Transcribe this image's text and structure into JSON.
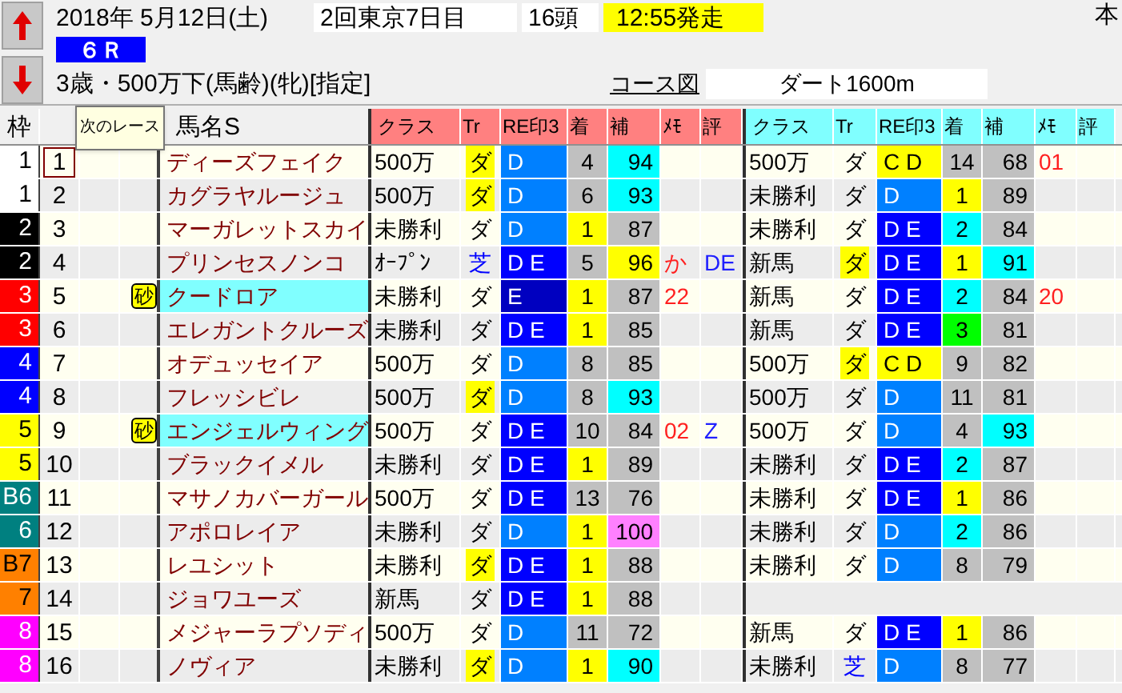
{
  "header": {
    "date": "2018年 5月12日(土)",
    "meeting": "2回東京7日目",
    "runners": "16頭",
    "start_time": "12:55発走",
    "edge_text": "本",
    "race_no": "６Ｒ",
    "conditions": "3歳・500万下(馬齢)(牝)[指定]",
    "course_link": "コース図",
    "course": "ダート1600m"
  },
  "tooltip": "次のレース",
  "columns": {
    "waku": "枠",
    "name": "馬名S",
    "cur_group": [
      "クラス",
      "Tr",
      "RE印3",
      "着",
      "補",
      "ﾒﾓ",
      "評"
    ],
    "prev_group": [
      "クラス",
      "Tr",
      "RE印3",
      "着",
      "補",
      "ﾒﾓ",
      "評"
    ]
  },
  "rows": [
    {
      "waku": "1",
      "color": "#ffffff",
      "num": "1",
      "selected": true,
      "sand": false,
      "name": "ディーズフェイク",
      "name_hl": false,
      "cur": {
        "cls": "500万",
        "tr": {
          "text": "ダ",
          "hl": true
        },
        "re": {
          "text": "D",
          "color": "#0080ff"
        },
        "chaku": {
          "text": "4",
          "color": "#c0c0c0"
        },
        "ho": {
          "text": "94",
          "color": "#00ffff"
        }
      },
      "prev": {
        "cls": "500万",
        "tr": {
          "text": "ダ",
          "hl": false
        },
        "re": {
          "text": "C D",
          "color": "#ffff00"
        },
        "chaku": {
          "text": "14",
          "color": "#c0c0c0"
        },
        "ho": {
          "text": "68",
          "color": "#c0c0c0"
        },
        "memo": "01"
      }
    },
    {
      "waku": "1",
      "color": "#ffffff",
      "num": "2",
      "selected": false,
      "sand": false,
      "name": "カグラヤルージュ",
      "name_hl": false,
      "cur": {
        "cls": "500万",
        "tr": {
          "text": "ダ",
          "hl": true
        },
        "re": {
          "text": "D",
          "color": "#0080ff"
        },
        "chaku": {
          "text": "6",
          "color": "#c0c0c0"
        },
        "ho": {
          "text": "93",
          "color": "#00ffff"
        }
      },
      "prev": {
        "cls": "未勝利",
        "tr": {
          "text": "ダ",
          "hl": false
        },
        "re": {
          "text": "D",
          "color": "#0080ff"
        },
        "chaku": {
          "text": "1",
          "color": "#ffff00"
        },
        "ho": {
          "text": "89",
          "color": "#c0c0c0"
        }
      }
    },
    {
      "waku": "2",
      "color": "#000000",
      "num": "3",
      "selected": false,
      "sand": false,
      "name": "マーガレットスカイ",
      "name_hl": false,
      "cur": {
        "cls": "未勝利",
        "tr": {
          "text": "ダ",
          "hl": false
        },
        "re": {
          "text": "D",
          "color": "#0080ff"
        },
        "chaku": {
          "text": "1",
          "color": "#ffff00"
        },
        "ho": {
          "text": "87",
          "color": "#c0c0c0"
        }
      },
      "prev": {
        "cls": "未勝利",
        "tr": {
          "text": "ダ",
          "hl": false
        },
        "re": {
          "text": "D E",
          "color": "#0000ff"
        },
        "chaku": {
          "text": "2",
          "color": "#00ffff"
        },
        "ho": {
          "text": "84",
          "color": "#c0c0c0"
        }
      }
    },
    {
      "waku": "2",
      "color": "#000000",
      "num": "4",
      "selected": false,
      "sand": false,
      "name": "プリンセスノンコ",
      "name_hl": false,
      "cur": {
        "cls": "ｵｰﾌﾟﾝ",
        "tr": {
          "text": "芝",
          "hl": false,
          "color": "#0000ff"
        },
        "re": {
          "text": "D E",
          "color": "#0000ff"
        },
        "chaku": {
          "text": "5",
          "color": "#c0c0c0"
        },
        "ho": {
          "text": "96",
          "color": "#ffff00"
        },
        "memo": "か",
        "hyo": "DE"
      },
      "prev": {
        "cls": "新馬",
        "tr": {
          "text": "ダ",
          "hl": true
        },
        "re": {
          "text": "D E",
          "color": "#0000ff"
        },
        "chaku": {
          "text": "1",
          "color": "#ffff00"
        },
        "ho": {
          "text": "91",
          "color": "#00ffff"
        }
      }
    },
    {
      "waku": "3",
      "color": "#ff0000",
      "num": "5",
      "selected": false,
      "sand": true,
      "sand_label": "砂",
      "name": "クードロア",
      "name_hl": true,
      "cur": {
        "cls": "未勝利",
        "tr": {
          "text": "ダ",
          "hl": false
        },
        "re": {
          "text": "E",
          "color": "#0000c0"
        },
        "chaku": {
          "text": "1",
          "color": "#ffff00"
        },
        "ho": {
          "text": "87",
          "color": "#c0c0c0"
        },
        "memo": "22"
      },
      "prev": {
        "cls": "新馬",
        "tr": {
          "text": "ダ",
          "hl": false
        },
        "re": {
          "text": "D E",
          "color": "#0000ff"
        },
        "chaku": {
          "text": "2",
          "color": "#00ffff"
        },
        "ho": {
          "text": "84",
          "color": "#c0c0c0"
        },
        "memo": "20"
      }
    },
    {
      "waku": "3",
      "color": "#ff0000",
      "num": "6",
      "selected": false,
      "sand": false,
      "name": "エレガントクルーズ",
      "name_hl": false,
      "cur": {
        "cls": "未勝利",
        "tr": {
          "text": "ダ",
          "hl": false
        },
        "re": {
          "text": "D E",
          "color": "#0000ff"
        },
        "chaku": {
          "text": "1",
          "color": "#ffff00"
        },
        "ho": {
          "text": "85",
          "color": "#c0c0c0"
        }
      },
      "prev": {
        "cls": "新馬",
        "tr": {
          "text": "ダ",
          "hl": false
        },
        "re": {
          "text": "D E",
          "color": "#0000ff"
        },
        "chaku": {
          "text": "3",
          "color": "#00ff00"
        },
        "ho": {
          "text": "81",
          "color": "#c0c0c0"
        }
      }
    },
    {
      "waku": "4",
      "color": "#0000ff",
      "num": "7",
      "selected": false,
      "sand": false,
      "name": "オデュッセイア",
      "name_hl": false,
      "cur": {
        "cls": "500万",
        "tr": {
          "text": "ダ",
          "hl": false
        },
        "re": {
          "text": "D",
          "color": "#0080ff"
        },
        "chaku": {
          "text": "8",
          "color": "#c0c0c0"
        },
        "ho": {
          "text": "85",
          "color": "#c0c0c0"
        }
      },
      "prev": {
        "cls": "500万",
        "tr": {
          "text": "ダ",
          "hl": true
        },
        "re": {
          "text": "C D",
          "color": "#ffff00"
        },
        "chaku": {
          "text": "9",
          "color": "#c0c0c0"
        },
        "ho": {
          "text": "82",
          "color": "#c0c0c0"
        }
      }
    },
    {
      "waku": "4",
      "color": "#0000ff",
      "num": "8",
      "selected": false,
      "sand": false,
      "name": "フレッシビレ",
      "name_hl": false,
      "cur": {
        "cls": "500万",
        "tr": {
          "text": "ダ",
          "hl": true
        },
        "re": {
          "text": "D",
          "color": "#0080ff"
        },
        "chaku": {
          "text": "8",
          "color": "#c0c0c0"
        },
        "ho": {
          "text": "93",
          "color": "#00ffff"
        }
      },
      "prev": {
        "cls": "500万",
        "tr": {
          "text": "ダ",
          "hl": false
        },
        "re": {
          "text": "D",
          "color": "#0080ff"
        },
        "chaku": {
          "text": "11",
          "color": "#c0c0c0"
        },
        "ho": {
          "text": "81",
          "color": "#c0c0c0"
        }
      }
    },
    {
      "waku": "5",
      "color": "#ffff00",
      "num": "9",
      "selected": false,
      "sand": true,
      "sand_label": "砂",
      "name": "エンジェルウィング",
      "name_hl": true,
      "cur": {
        "cls": "500万",
        "tr": {
          "text": "ダ",
          "hl": false
        },
        "re": {
          "text": "D E",
          "color": "#0000ff"
        },
        "chaku": {
          "text": "10",
          "color": "#c0c0c0"
        },
        "ho": {
          "text": "84",
          "color": "#c0c0c0"
        },
        "memo": "02",
        "hyo": "Z"
      },
      "prev": {
        "cls": "500万",
        "tr": {
          "text": "ダ",
          "hl": false
        },
        "re": {
          "text": "D",
          "color": "#0080ff"
        },
        "chaku": {
          "text": "4",
          "color": "#c0c0c0"
        },
        "ho": {
          "text": "93",
          "color": "#00ffff"
        }
      }
    },
    {
      "waku": "5",
      "color": "#ffff00",
      "num": "10",
      "selected": false,
      "sand": false,
      "name": "ブラックイメル",
      "name_hl": false,
      "cur": {
        "cls": "未勝利",
        "tr": {
          "text": "ダ",
          "hl": false
        },
        "re": {
          "text": "D E",
          "color": "#0000ff"
        },
        "chaku": {
          "text": "1",
          "color": "#ffff00"
        },
        "ho": {
          "text": "89",
          "color": "#c0c0c0"
        }
      },
      "prev": {
        "cls": "未勝利",
        "tr": {
          "text": "ダ",
          "hl": false
        },
        "re": {
          "text": "D E",
          "color": "#0000ff"
        },
        "chaku": {
          "text": "2",
          "color": "#00ffff"
        },
        "ho": {
          "text": "87",
          "color": "#c0c0c0"
        }
      }
    },
    {
      "waku": "B6",
      "color": "#008080",
      "num": "11",
      "selected": false,
      "sand": false,
      "name": "マサノカバーガール",
      "name_hl": false,
      "cur": {
        "cls": "500万",
        "tr": {
          "text": "ダ",
          "hl": false
        },
        "re": {
          "text": "D E",
          "color": "#0000ff"
        },
        "chaku": {
          "text": "13",
          "color": "#c0c0c0"
        },
        "ho": {
          "text": "76",
          "color": "#c0c0c0"
        }
      },
      "prev": {
        "cls": "未勝利",
        "tr": {
          "text": "ダ",
          "hl": false
        },
        "re": {
          "text": "D E",
          "color": "#0000ff"
        },
        "chaku": {
          "text": "1",
          "color": "#ffff00"
        },
        "ho": {
          "text": "86",
          "color": "#c0c0c0"
        }
      }
    },
    {
      "waku": "6",
      "color": "#008080",
      "num": "12",
      "selected": false,
      "sand": false,
      "name": "アポロレイア",
      "name_hl": false,
      "cur": {
        "cls": "未勝利",
        "tr": {
          "text": "ダ",
          "hl": false
        },
        "re": {
          "text": "D",
          "color": "#0080ff"
        },
        "chaku": {
          "text": "1",
          "color": "#ffff00"
        },
        "ho": {
          "text": "100",
          "color": "#ff80ff"
        }
      },
      "prev": {
        "cls": "未勝利",
        "tr": {
          "text": "ダ",
          "hl": false
        },
        "re": {
          "text": "D",
          "color": "#0080ff"
        },
        "chaku": {
          "text": "2",
          "color": "#00ffff"
        },
        "ho": {
          "text": "86",
          "color": "#c0c0c0"
        }
      }
    },
    {
      "waku": "B7",
      "color": "#ff8000",
      "num": "13",
      "selected": false,
      "sand": false,
      "name": "レユシット",
      "name_hl": false,
      "cur": {
        "cls": "未勝利",
        "tr": {
          "text": "ダ",
          "hl": true
        },
        "re": {
          "text": "D E",
          "color": "#0000ff"
        },
        "chaku": {
          "text": "1",
          "color": "#ffff00"
        },
        "ho": {
          "text": "88",
          "color": "#c0c0c0"
        }
      },
      "prev": {
        "cls": "未勝利",
        "tr": {
          "text": "ダ",
          "hl": false
        },
        "re": {
          "text": "D",
          "color": "#0080ff"
        },
        "chaku": {
          "text": "8",
          "color": "#c0c0c0"
        },
        "ho": {
          "text": "79",
          "color": "#c0c0c0"
        }
      }
    },
    {
      "waku": "7",
      "color": "#ff8000",
      "num": "14",
      "selected": false,
      "sand": false,
      "name": "ジョワユーズ",
      "name_hl": false,
      "cur": {
        "cls": "新馬",
        "tr": {
          "text": "ダ",
          "hl": false
        },
        "re": {
          "text": "D E",
          "color": "#0000ff"
        },
        "chaku": {
          "text": "1",
          "color": "#ffff00"
        },
        "ho": {
          "text": "88",
          "color": "#c0c0c0"
        }
      }
    },
    {
      "waku": "8",
      "color": "#ff00ff",
      "num": "15",
      "selected": false,
      "sand": false,
      "name": "メジャーラプソディ",
      "name_hl": false,
      "cur": {
        "cls": "500万",
        "tr": {
          "text": "ダ",
          "hl": false
        },
        "re": {
          "text": "D",
          "color": "#0080ff"
        },
        "chaku": {
          "text": "11",
          "color": "#c0c0c0"
        },
        "ho": {
          "text": "72",
          "color": "#c0c0c0"
        }
      },
      "prev": {
        "cls": "新馬",
        "tr": {
          "text": "ダ",
          "hl": false
        },
        "re": {
          "text": "D E",
          "color": "#0000ff"
        },
        "chaku": {
          "text": "1",
          "color": "#ffff00"
        },
        "ho": {
          "text": "86",
          "color": "#c0c0c0"
        }
      }
    },
    {
      "waku": "8",
      "color": "#ff00ff",
      "num": "16",
      "selected": false,
      "sand": false,
      "name": "ノヴィア",
      "name_hl": false,
      "cur": {
        "cls": "未勝利",
        "tr": {
          "text": "ダ",
          "hl": true
        },
        "re": {
          "text": "D",
          "color": "#0080ff"
        },
        "chaku": {
          "text": "1",
          "color": "#ffff00"
        },
        "ho": {
          "text": "90",
          "color": "#00ffff"
        }
      },
      "prev": {
        "cls": "未勝利",
        "tr": {
          "text": "芝",
          "hl": false,
          "color": "#0000ff"
        },
        "re": {
          "text": "D",
          "color": "#0080ff"
        },
        "chaku": {
          "text": "8",
          "color": "#c0c0c0"
        },
        "ho": {
          "text": "77",
          "color": "#c0c0c0"
        }
      }
    }
  ]
}
